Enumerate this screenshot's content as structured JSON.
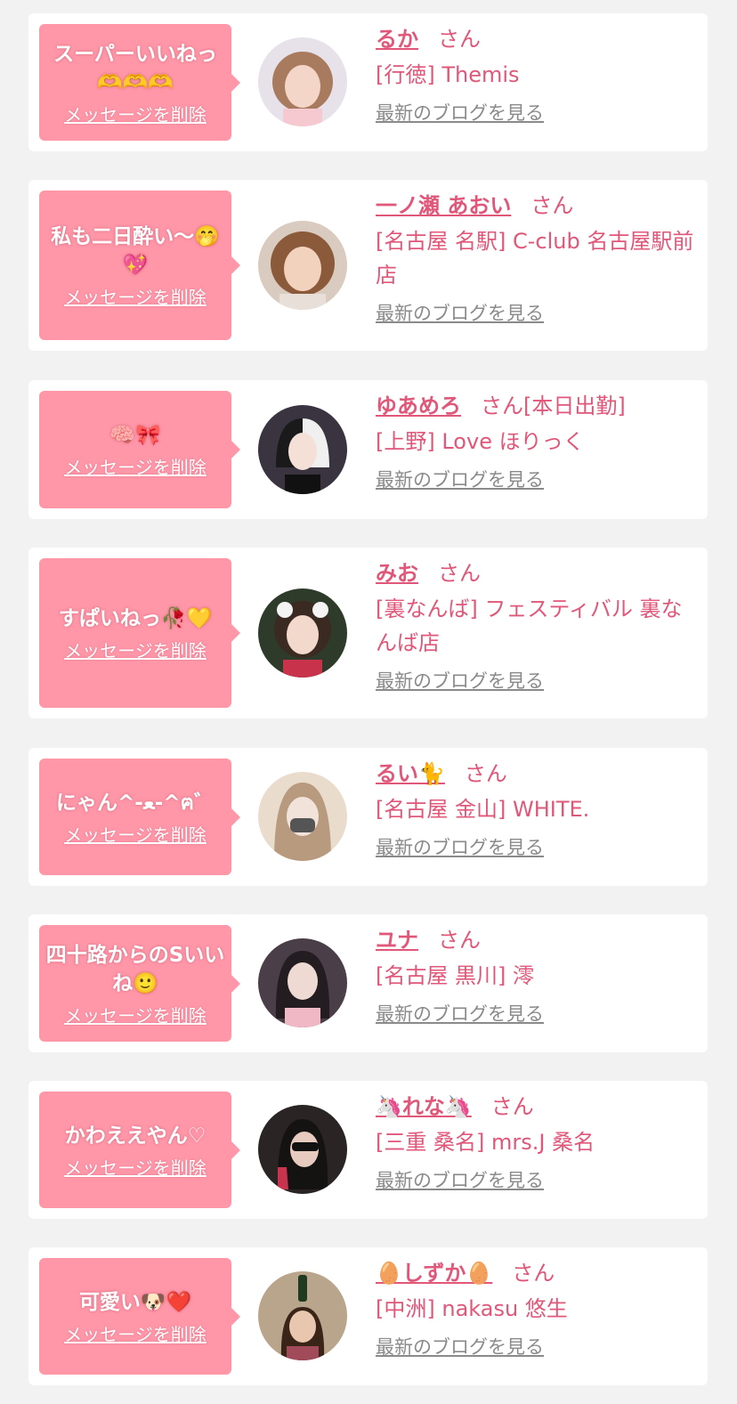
{
  "entries": [
    {
      "message": "スーパーいいねっ🫶🫶🫶",
      "delete_label": "メッセージを削除",
      "name": "るか",
      "suffix": "さん",
      "shop": "[行徳] Themis",
      "blog_link": "最新のブログを見る",
      "avatar_icon": "profile-photo"
    },
    {
      "message": "私も二日酔い〜🤭💖",
      "delete_label": "メッセージを削除",
      "name": "一ノ瀬 あおい",
      "suffix": "さん",
      "shop": "[名古屋 名駅] C-club 名古屋駅前店",
      "blog_link": "最新のブログを見る",
      "avatar_icon": "profile-photo"
    },
    {
      "message": "🧠🎀",
      "delete_label": "メッセージを削除",
      "name": "ゆあめろ",
      "suffix": "さん[本日出勤]",
      "shop": "[上野] Love ほりっく",
      "blog_link": "最新のブログを見る",
      "avatar_icon": "profile-photo"
    },
    {
      "message": "すぱいねっ🥀💛",
      "delete_label": "メッセージを削除",
      "name": "みお",
      "suffix": "さん",
      "shop": "[裏なんば] フェスティバル 裏なんば店",
      "blog_link": "最新のブログを見る",
      "avatar_icon": "profile-photo"
    },
    {
      "message": "にゃん^-ﻌ-^ฅ゛",
      "delete_label": "メッセージを削除",
      "name": "るい🐈",
      "suffix": "さん",
      "shop": "[名古屋 金山] WHITE.",
      "blog_link": "最新のブログを見る",
      "avatar_icon": "profile-photo"
    },
    {
      "message": "四十路からのSいいね🙂",
      "delete_label": "メッセージを削除",
      "name": "ユナ",
      "suffix": "さん",
      "shop": "[名古屋 黒川] 澪",
      "blog_link": "最新のブログを見る",
      "avatar_icon": "profile-photo"
    },
    {
      "message": "かわええやん♡",
      "delete_label": "メッセージを削除",
      "name": "🦄れな🦄",
      "suffix": "さん",
      "shop": "[三重 桑名] mrs.J 桑名",
      "blog_link": "最新のブログを見る",
      "avatar_icon": "profile-photo"
    },
    {
      "message": "可愛い🐶❤️",
      "delete_label": "メッセージを削除",
      "name": "🥚しずか🥚",
      "suffix": "さん",
      "shop": "[中洲] nakasu 悠生",
      "blog_link": "最新のブログを見る",
      "avatar_icon": "profile-photo"
    }
  ],
  "colors": {
    "background": "#f2f2f2",
    "card": "#ffffff",
    "bubble": "#ff97a9",
    "name": "#e0577a",
    "link": "#8a8a8a"
  }
}
